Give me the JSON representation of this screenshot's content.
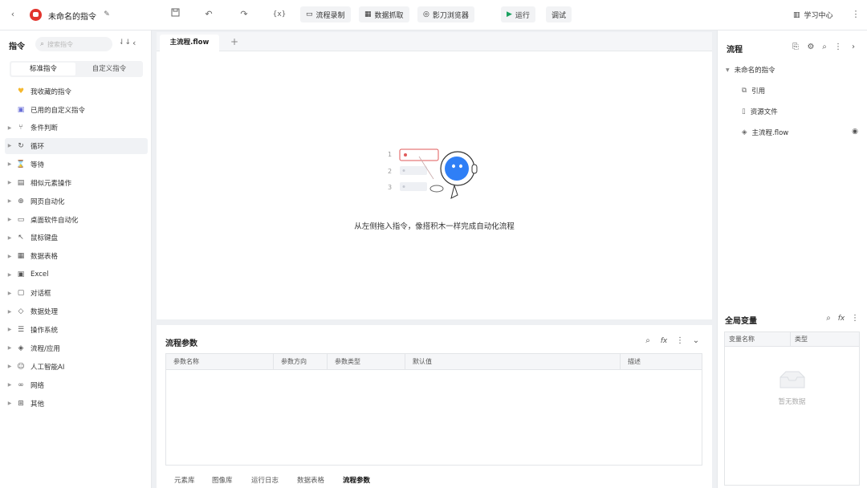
{
  "header": {
    "back_icon": "chevron-left-icon",
    "app_logo": "robot-logo",
    "title": "未命名的指令",
    "toolbar": {
      "record_label": "流程录制",
      "extract_label": "数据抓取",
      "browser_label": "影刀浏览器",
      "run_label": "运行",
      "debug_label": "调试",
      "var_symbol": "{x}"
    },
    "learn_label": "学习中心"
  },
  "left": {
    "title": "指令",
    "search_placeholder": "搜索指令",
    "tabs": [
      "标准指令",
      "自定义指令"
    ],
    "favorites_label": "我收藏的指令",
    "used_custom_label": "已用的自定义指令",
    "items": [
      {
        "label": "条件判断",
        "icon": "branch-icon"
      },
      {
        "label": "循环",
        "icon": "loop-icon"
      },
      {
        "label": "等待",
        "icon": "hourglass-icon"
      },
      {
        "label": "相似元素操作",
        "icon": "similar-icon"
      },
      {
        "label": "网页自动化",
        "icon": "globe-icon"
      },
      {
        "label": "桌面软件自动化",
        "icon": "monitor-icon"
      },
      {
        "label": "鼠标键盘",
        "icon": "cursor-icon"
      },
      {
        "label": "数据表格",
        "icon": "table-icon"
      },
      {
        "label": "Excel",
        "icon": "excel-icon"
      },
      {
        "label": "对话框",
        "icon": "dialog-icon"
      },
      {
        "label": "数据处理",
        "icon": "data-icon"
      },
      {
        "label": "操作系统",
        "icon": "os-icon"
      },
      {
        "label": "流程/应用",
        "icon": "layers-icon"
      },
      {
        "label": "人工智能AI",
        "icon": "ai-icon"
      },
      {
        "label": "网络",
        "icon": "network-icon"
      },
      {
        "label": "其他",
        "icon": "grid-icon"
      }
    ]
  },
  "editor": {
    "tab_label": "主流程.flow",
    "illustration_numbers": [
      "1",
      "2",
      "3"
    ],
    "empty_hint": "从左侧拖入指令，像搭积木一样完成自动化流程"
  },
  "params": {
    "title": "流程参数",
    "columns": [
      "参数名称",
      "参数方向",
      "参数类型",
      "默认值",
      "描述"
    ],
    "bottom_tabs": [
      "元素库",
      "图像库",
      "运行日志",
      "数据表格",
      "流程参数"
    ],
    "active_tab": "流程参数"
  },
  "right": {
    "title": "流程",
    "tree_root": "未命名的指令",
    "tree_items": [
      "引用",
      "资源文件",
      "主流程.flow"
    ],
    "globals_title": "全局变量",
    "globals_columns": [
      "变量名称",
      "类型"
    ],
    "empty_text": "暂无数据"
  },
  "colors": {
    "accent": "#2f7ff6",
    "run_green": "#19a15f",
    "logo_red": "#e2342d"
  }
}
